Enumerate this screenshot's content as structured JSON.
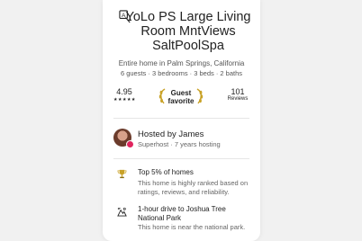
{
  "listing": {
    "title": "YoLo PS Large Living Room MntViews SaltPoolSpa",
    "subtitle": "Entire home in Palm Springs, California",
    "details": "6 guests · 3 bedrooms · 3 beds · 2 baths"
  },
  "stats": {
    "rating": "4.95",
    "stars": "★★★★★",
    "favorite_label": "Guest favorite",
    "reviews_count": "101",
    "reviews_label": "Reviews"
  },
  "host": {
    "name": "Hosted by James",
    "meta": "Superhost · 7 years hosting"
  },
  "highlights": [
    {
      "icon": "trophy-icon",
      "title": "Top 5% of homes",
      "description": "This home is highly ranked based on ratings, reviews, and reliability."
    },
    {
      "icon": "mountain-icon",
      "title": "1-hour drive to Joshua Tree National Park",
      "description": "This home is near the national park."
    }
  ],
  "colors": {
    "accent_pink": "#e0245e",
    "trophy_gold": "#c9a227",
    "text_dark": "#222222",
    "text_muted": "#666666"
  }
}
